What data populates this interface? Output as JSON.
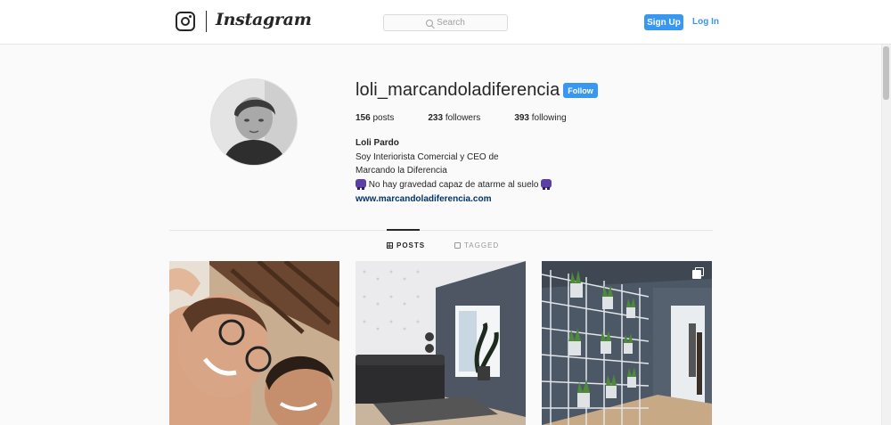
{
  "topbar": {
    "brand": "Instagram",
    "logo_icon": "instagram-camera-icon",
    "search_placeholder": "Search",
    "search_icon": "magnifier-icon",
    "signup_label": "Sign Up",
    "login_label": "Log In",
    "accent_color": "#3897f0"
  },
  "profile": {
    "username": "loli_marcandoladiferencia",
    "follow_label": "Follow",
    "stats": [
      {
        "count": "156",
        "label": "posts"
      },
      {
        "count": "233",
        "label": "followers"
      },
      {
        "count": "393",
        "label": "following"
      }
    ],
    "full_name": "Loli Pardo",
    "bio_lines": [
      "Soy Interiorista Comercial y CEO de",
      "Marcando la Diferencia",
      "No hay gravedad capaz de atarme al suelo"
    ],
    "bio_emoji_icon": "motor-scooter-icon",
    "website": "www.marcandoladiferencia.com"
  },
  "tabs": [
    {
      "label": "POSTS",
      "icon": "grid-icon",
      "active": true
    },
    {
      "label": "TAGGED",
      "icon": "tag-icon",
      "active": false
    }
  ],
  "posts": [
    {
      "subject": "selfie-photo",
      "multiple": false
    },
    {
      "subject": "living-room-photo",
      "multiple": false
    },
    {
      "subject": "plant-wall-photo",
      "multiple": true
    }
  ]
}
